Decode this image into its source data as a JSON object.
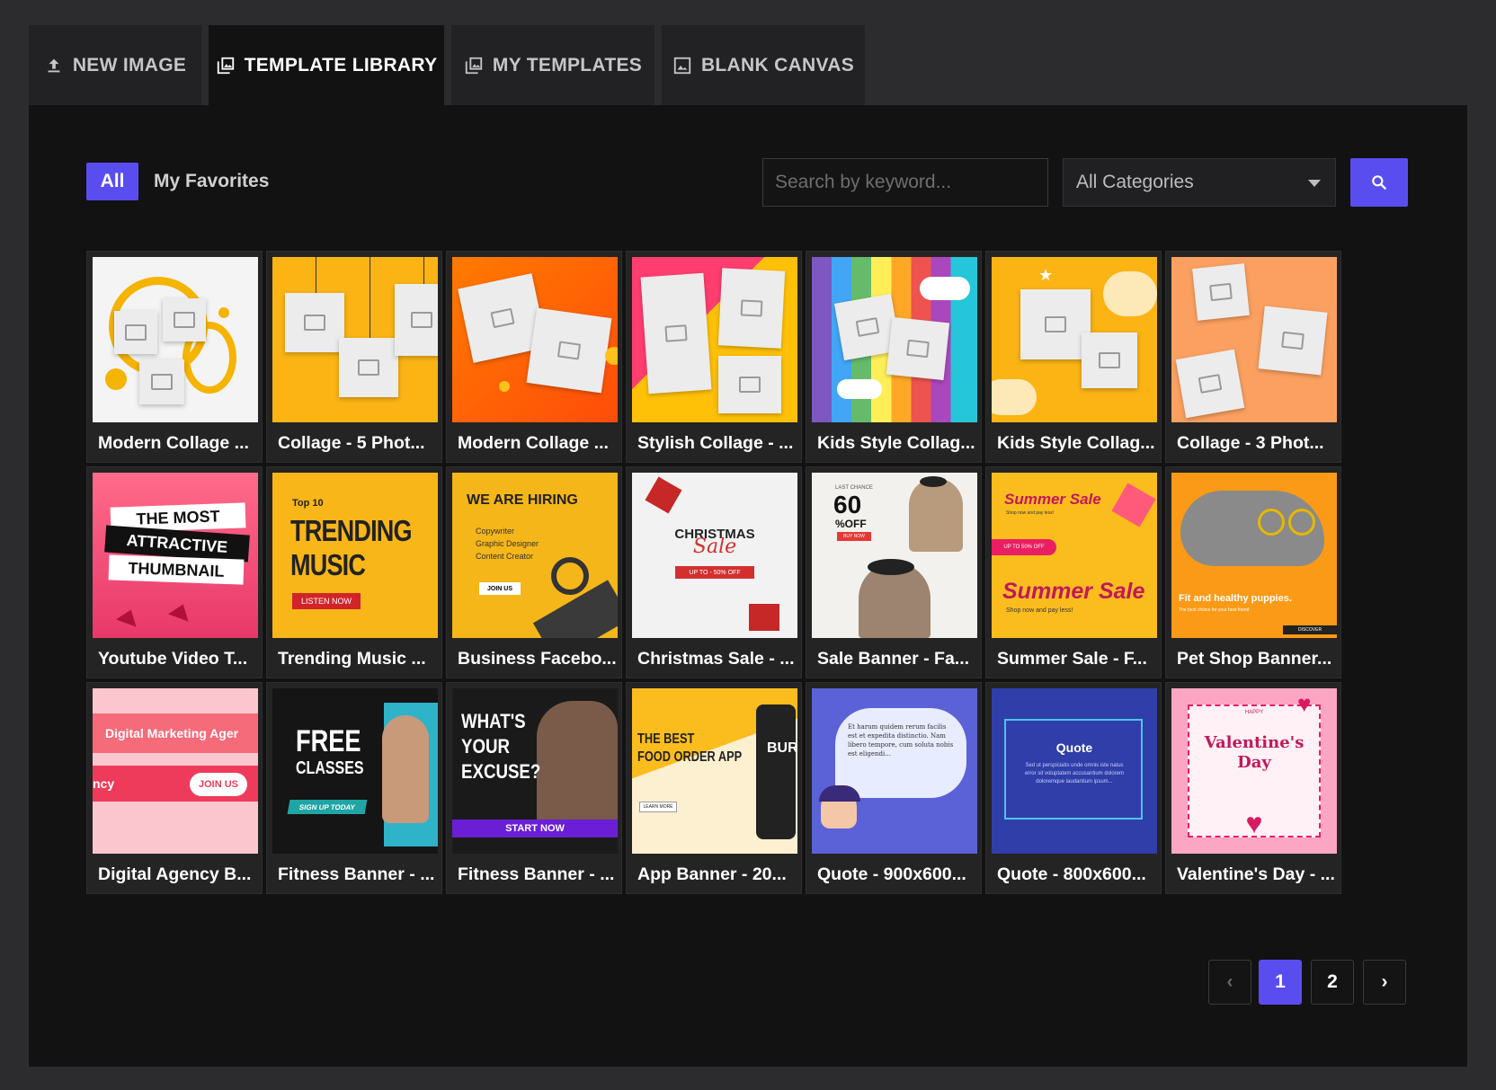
{
  "tabs": [
    {
      "label": "NEW IMAGE",
      "icon": "upload-icon"
    },
    {
      "label": "TEMPLATE LIBRARY",
      "icon": "image-library-icon"
    },
    {
      "label": "MY TEMPLATES",
      "icon": "my-templates-icon"
    },
    {
      "label": "BLANK CANVAS",
      "icon": "blank-canvas-icon"
    }
  ],
  "active_tab": "TEMPLATE LIBRARY",
  "filters": {
    "all": "All",
    "favorites": "My Favorites"
  },
  "search": {
    "placeholder": "Search by keyword...",
    "value": ""
  },
  "category": {
    "selected": "All Categories"
  },
  "colors": {
    "accent": "#5a4df0",
    "panel": "#121212",
    "card": "#242424"
  },
  "templates": [
    {
      "title": "Modern Collage ...",
      "thumb_text": []
    },
    {
      "title": "Collage - 5 Phot...",
      "thumb_text": []
    },
    {
      "title": "Modern Collage ...",
      "thumb_text": []
    },
    {
      "title": "Stylish Collage - ...",
      "thumb_text": []
    },
    {
      "title": "Kids Style Collag...",
      "thumb_text": []
    },
    {
      "title": "Kids Style Collag...",
      "thumb_text": []
    },
    {
      "title": "Collage - 3 Phot...",
      "thumb_text": []
    },
    {
      "title": "Youtube Video T...",
      "thumb_text": [
        "THE MOST",
        "ATTRACTIVE",
        "THUMBNAIL"
      ]
    },
    {
      "title": "Trending Music ...",
      "thumb_text": [
        "Top 10",
        "TRENDING",
        "MUSIC",
        "LISTEN NOW"
      ]
    },
    {
      "title": "Business Facebo...",
      "thumb_text": [
        "WE ARE HIRING",
        "Copywriter",
        "Graphic Designer",
        "Content Creator",
        "JOIN US"
      ]
    },
    {
      "title": "Christmas Sale - ...",
      "thumb_text": [
        "CHRISTMAS",
        "Sale",
        "UP TO - 50% OFF"
      ]
    },
    {
      "title": "Sale Banner - Fa...",
      "thumb_text": [
        "LAST CHANCE",
        "60",
        "%OFF",
        "BUY NOW"
      ]
    },
    {
      "title": "Summer Sale - F...",
      "thumb_text": [
        "Summer Sale",
        "Shop now and pay less!",
        "UP TO 50% OFF",
        "Summer Sale",
        "Shop now and pay less!"
      ]
    },
    {
      "title": "Pet Shop Banner...",
      "thumb_text": [
        "Fit and healthy puppies.",
        "The best choice for your best friend",
        "DISCOVER"
      ]
    },
    {
      "title": "Digital Agency B...",
      "thumb_text": [
        "Digital Marketing Ager",
        "ncy",
        "JOIN US"
      ]
    },
    {
      "title": "Fitness Banner - ...",
      "thumb_text": [
        "FREE",
        "CLASSES",
        "SIGN UP TODAY"
      ]
    },
    {
      "title": "Fitness Banner - ...",
      "thumb_text": [
        "WHAT'S",
        "YOUR",
        "EXCUSE?",
        "START NOW"
      ]
    },
    {
      "title": "App Banner - 20...",
      "thumb_text": [
        "THE BEST",
        "FOOD ORDER APP",
        "LEARN MORE",
        "BUR"
      ]
    },
    {
      "title": "Quote - 900x600...",
      "thumb_text": [
        "Et harum quidem rerum facilis est et expedita distinctio. Nam libero tempore, cum soluta nobis est eligendi..."
      ]
    },
    {
      "title": "Quote - 800x600...",
      "thumb_text": [
        "Quote",
        "Sed ut perspiciatis unde omnis iste natus error sit voluptatem accusantium dolorem doloremque laudantium ipsum..."
      ]
    },
    {
      "title": "Valentine's Day - ...",
      "thumb_text": [
        "HAPPY",
        "Valentine's",
        "Day"
      ]
    }
  ],
  "pagination": {
    "pages": [
      "1",
      "2"
    ],
    "current": "1",
    "prev": "‹",
    "next": "›"
  }
}
